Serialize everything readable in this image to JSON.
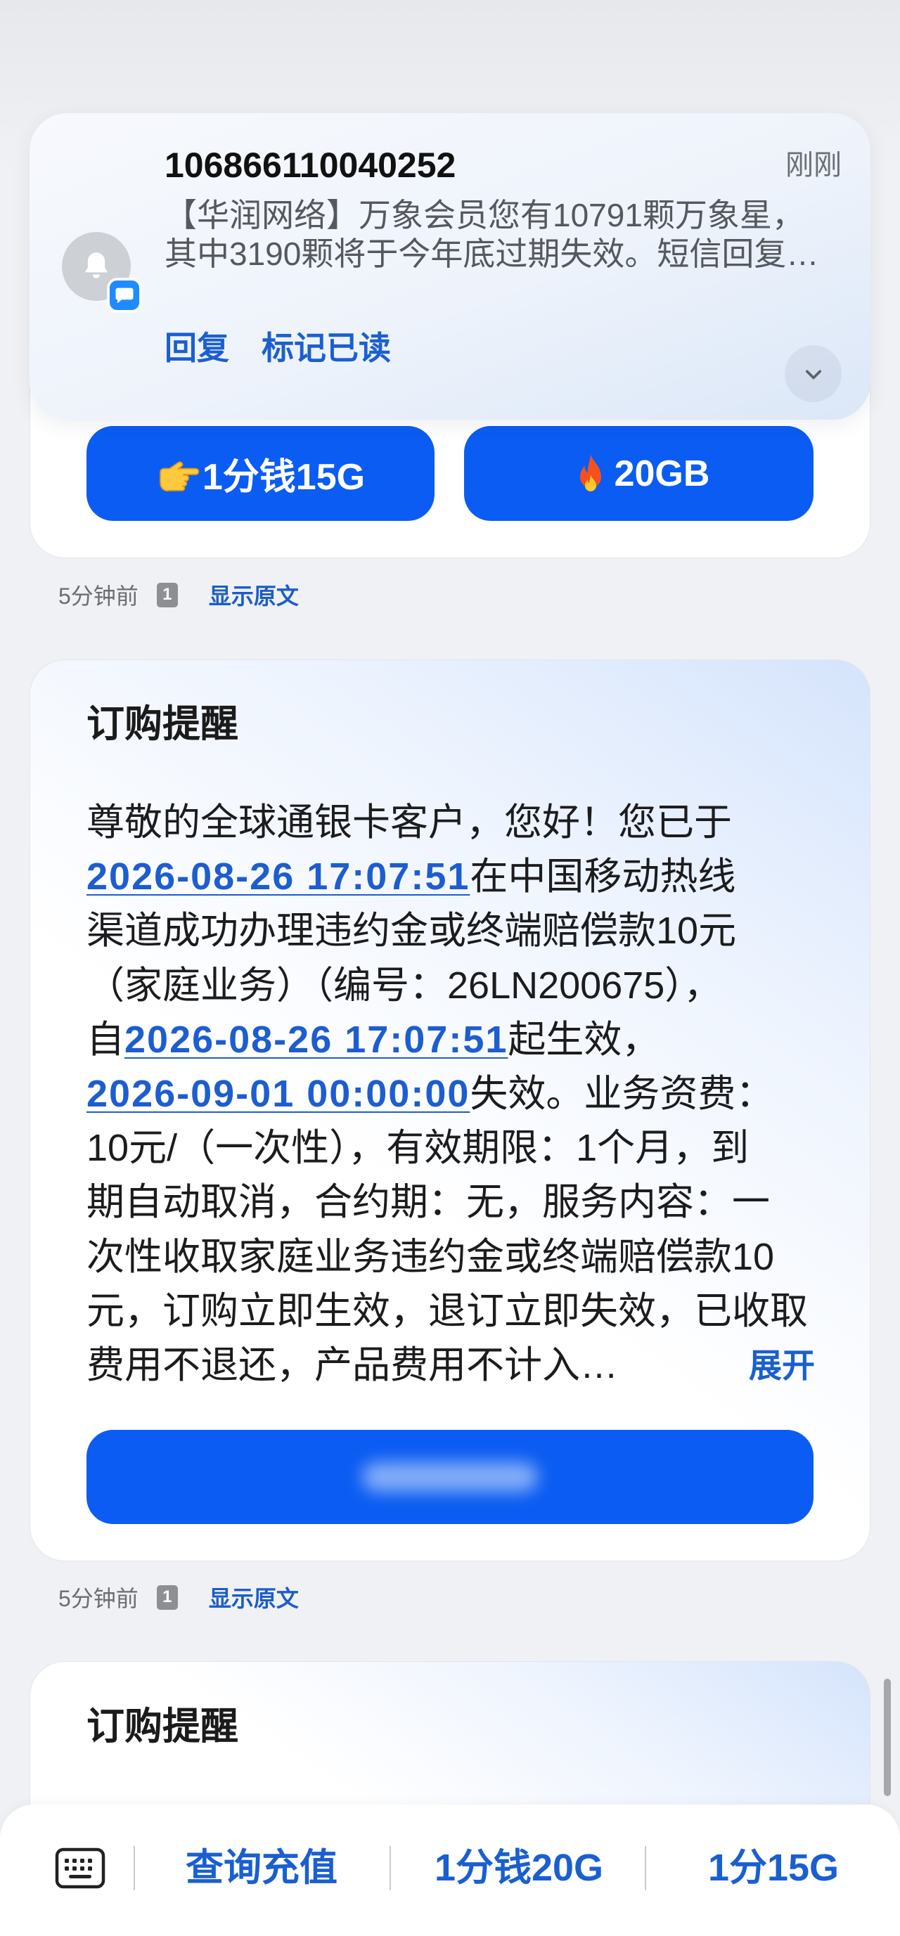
{
  "notification": {
    "sender": "106866110040252",
    "time": "刚刚",
    "message_lines": [
      "【华润网络】万象会员您有10791颗万象星，",
      "其中3190颗将于今年底过期失效。短信回复…"
    ],
    "actions": [
      "回复",
      "标记已读"
    ],
    "avatar_icon": "bell-icon",
    "badge_icon": "message-icon",
    "expand_icon": "chevron-down-icon"
  },
  "promo_card": {
    "buttons": [
      {
        "icon": "pointing-hand-icon",
        "label": "1分钱15G"
      },
      {
        "icon": "fire-icon",
        "label": "20GB"
      }
    ]
  },
  "message_meta": [
    {
      "time": "5分钟前",
      "sim": "1",
      "show_original": "显示原文"
    },
    {
      "time": "5分钟前",
      "sim": "1",
      "show_original": "显示原文"
    }
  ],
  "order_card": {
    "title": "订购提醒",
    "body_lines": [
      [
        "尊敬的全球通银卡客户，您好！您已于"
      ],
      [
        "2026-08-26 17:07:51",
        "在中国移动热线"
      ],
      [
        "渠道成功办理违约金或终端赔偿款10元"
      ],
      [
        "（家庭业务）（编号：26LN200675），"
      ],
      [
        "自",
        "2026-08-26 17:07:51",
        "起生效，"
      ],
      [
        "2026-09-01 00:00:00",
        "失效。业务资费："
      ],
      [
        "10元/（一次性），有效期限：1个月，到"
      ],
      [
        "期自动取消，合约期：无，服务内容：一"
      ],
      [
        "次性收取家庭业务违约金或终端赔偿款10"
      ],
      [
        "元，订购立即生效，退订立即失效，已收取"
      ],
      [
        "费用不退还，产品费用不计入…"
      ]
    ],
    "expand_label": "展开"
  },
  "next_card": {
    "title": "订购提醒"
  },
  "bottom_bar": {
    "keyboard_icon": "keyboard-icon",
    "quick_replies": [
      "查询充值",
      "1分钱20G",
      "1分15G"
    ]
  },
  "colors": {
    "accent": "#0b5cf2",
    "link": "#1d5dcf",
    "background": "#f0f1f4"
  }
}
